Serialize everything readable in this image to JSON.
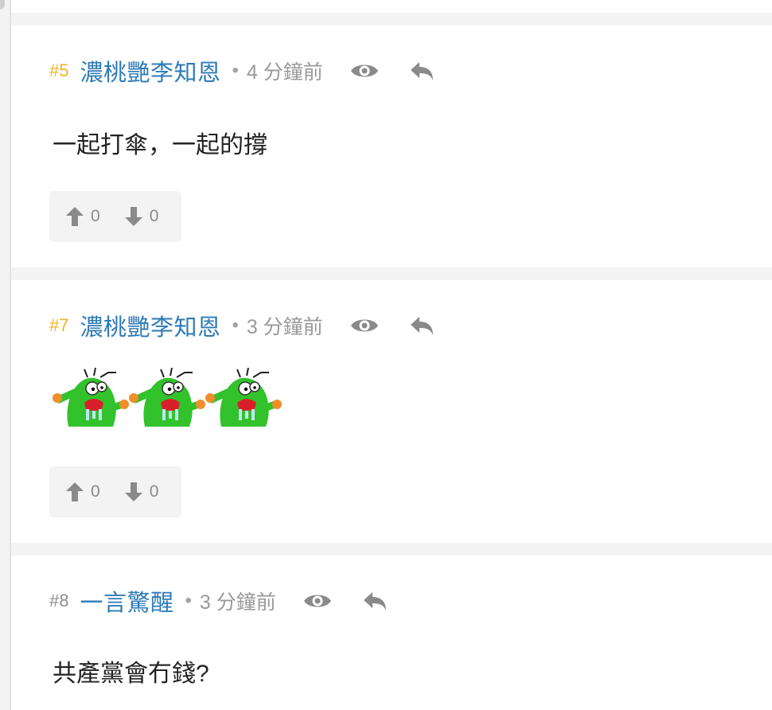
{
  "posts": [
    {
      "number": "#5",
      "author": "濃桃艷李知恩",
      "separator": "•",
      "time": "4 分鐘前",
      "content": "一起打傘，一起的撐",
      "upvotes": "0",
      "downvotes": "0"
    },
    {
      "number": "#7",
      "author": "濃桃艷李知恩",
      "separator": "•",
      "time": "3 分鐘前",
      "sticker_count": 3,
      "upvotes": "0",
      "downvotes": "0"
    },
    {
      "number": "#8",
      "author": "一言驚醒",
      "separator": "•",
      "time": "3 分鐘前",
      "content": "共產黨會冇錢?"
    }
  ],
  "icons": {
    "view": "eye-icon",
    "reply": "reply-icon",
    "upvote": "arrow-up-icon",
    "downvote": "arrow-down-icon"
  },
  "colors": {
    "author": "#2e7bb7",
    "number_highlight": "#f0b429",
    "number_plain": "#8e8e8e",
    "meta": "#999999",
    "divider": "#f4f4f4"
  }
}
